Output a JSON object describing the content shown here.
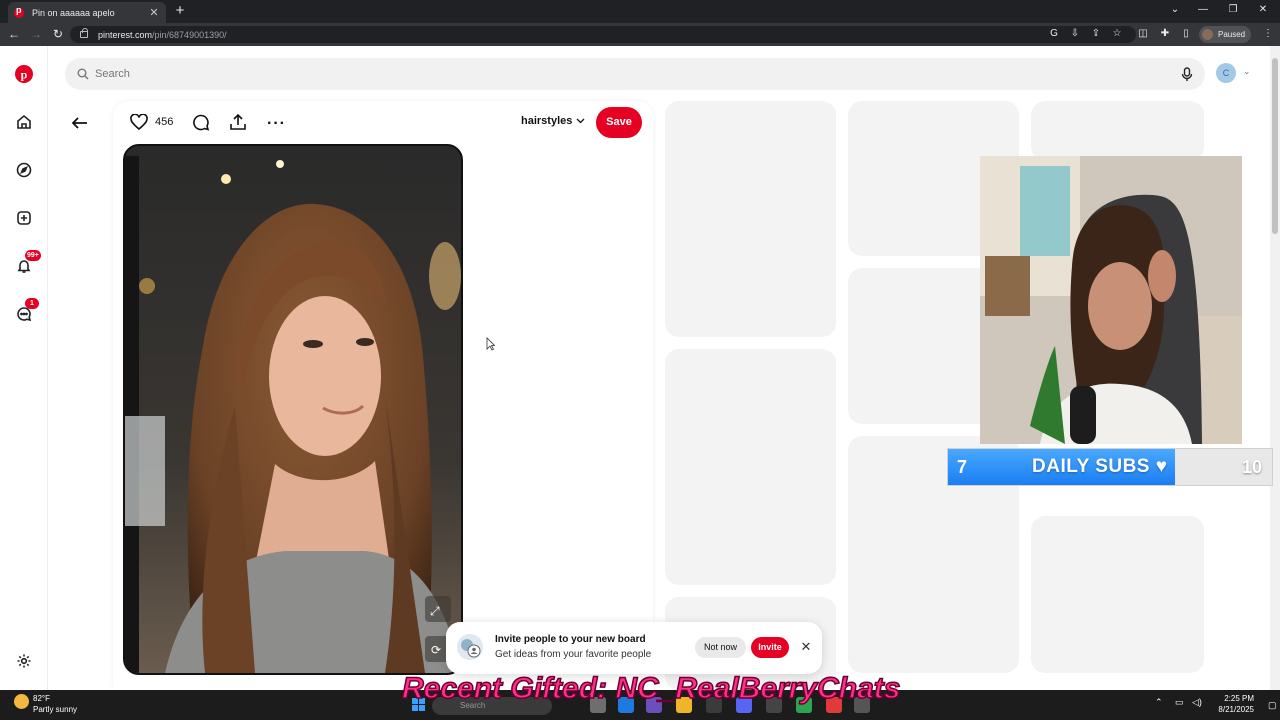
{
  "browser": {
    "tab_title": "Pin on aaaaaa apelo",
    "url_domain": "pinterest.com",
    "url_path": "/pin/68749001390/",
    "profile_status": "Paused"
  },
  "search": {
    "placeholder": "Search",
    "avatar_initial": "C"
  },
  "rail": {
    "notifications_badge": "99+",
    "messages_badge": "1"
  },
  "pin": {
    "like_count": "456",
    "board_name": "hairstyles",
    "save_label": "Save"
  },
  "overlay": {
    "subs_current": "7",
    "subs_label": "DAILY SUBS",
    "subs_goal": "10",
    "subs_progress": 0.7,
    "gifted_ticker": "Recent Gifted: NC_RealBerryChats"
  },
  "toast": {
    "title": "Invite people to your new board",
    "subtitle": "Get ideas from your favorite people",
    "not_now_label": "Not now",
    "invite_label": "Invite"
  },
  "taskbar": {
    "weather_temp": "82°F",
    "weather_desc": "Partly sunny",
    "search_label": "Search",
    "time": "2:25 PM",
    "date": "8/21/2025"
  },
  "colors": {
    "brand": "#e60023",
    "subs_fill": "#1a7ef2"
  }
}
